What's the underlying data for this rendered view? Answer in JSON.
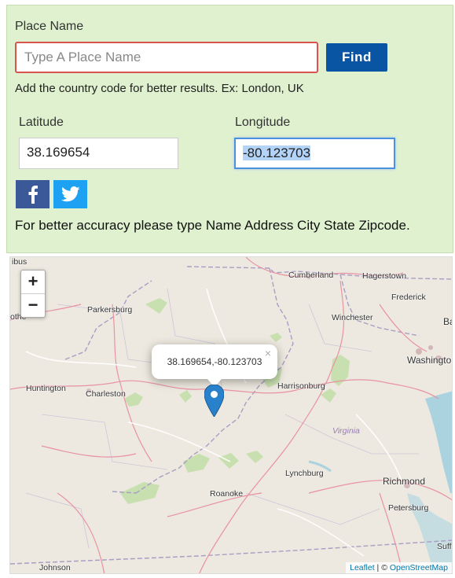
{
  "form": {
    "place_label": "Place Name",
    "place_placeholder": "Type A Place Name",
    "find_label": "Find",
    "hint": "Add the country code for better results. Ex: London, UK",
    "latitude_label": "Latitude",
    "latitude_value": "38.169654",
    "longitude_label": "Longitude",
    "longitude_value": "-80.123703",
    "accuracy_note": "For better accuracy please type Name Address City State Zipcode."
  },
  "social": {
    "facebook_icon": "facebook-icon",
    "twitter_icon": "twitter-icon"
  },
  "map": {
    "zoom_in": "+",
    "zoom_out": "−",
    "popup_text": "38.169654,-80.123703",
    "popup_close": "×",
    "cities": {
      "cumberland": "Cumberland",
      "hagerstown": "Hagerstown",
      "frederick": "Frederick",
      "parkersburg": "Parkersburg",
      "winchester": "Winchester",
      "washington": "Washington",
      "huntington": "Huntington",
      "charleston": "Charleston",
      "harrisonburg": "Harrisonburg",
      "lynchburg": "Lynchburg",
      "roanoke": "Roanoke",
      "richmond": "Richmond",
      "petersburg": "Petersburg",
      "johnson": "Johnson",
      "bus_partial": "ibus",
      "othe_partial": "othe",
      "ba_partial": "Ba",
      "suff_partial": "Suff"
    },
    "state_label": "Virginia",
    "attribution_leaflet": "Leaflet",
    "attribution_sep": " | © ",
    "attribution_osm": "OpenStreetMap"
  }
}
